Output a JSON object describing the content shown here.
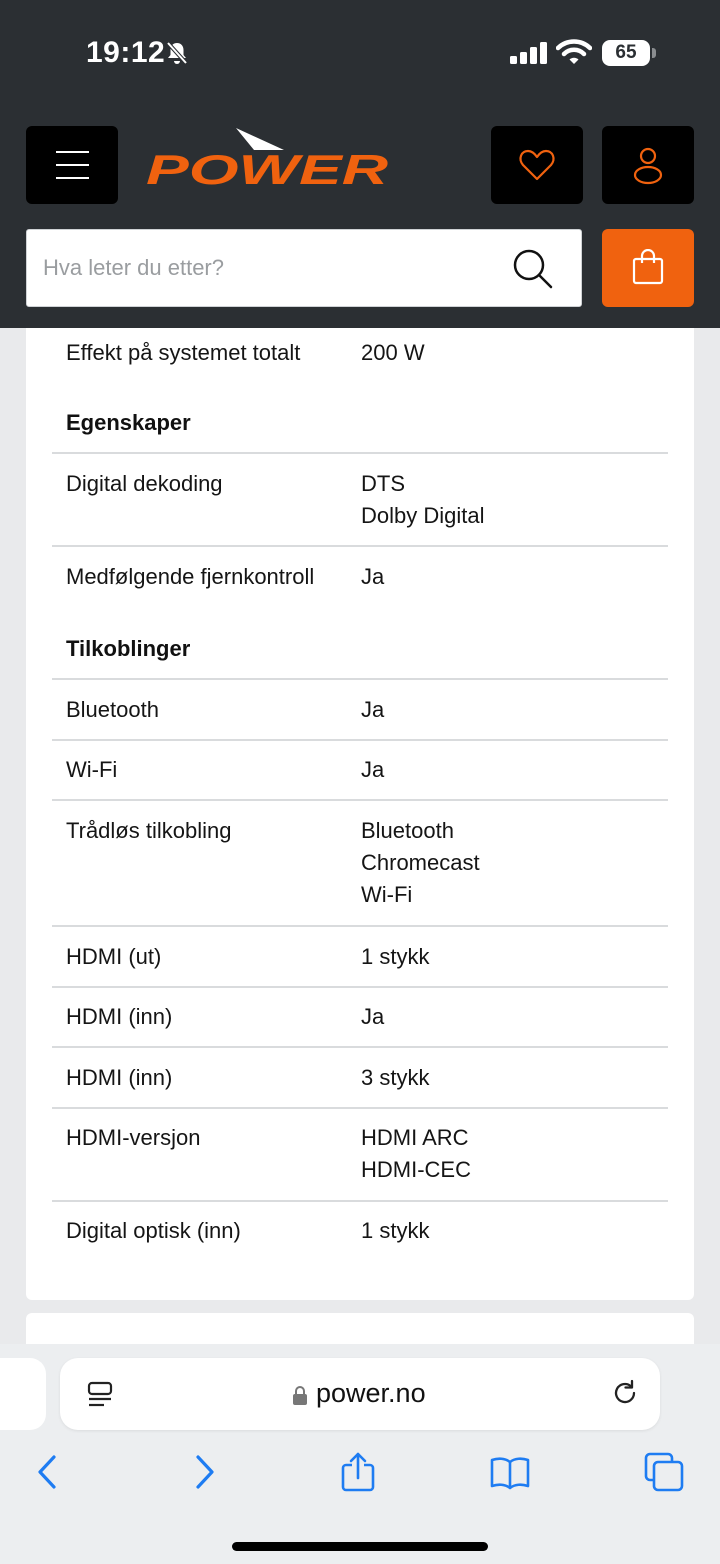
{
  "status_bar": {
    "time": "19:12",
    "battery": "65"
  },
  "header": {
    "logo_text": "POWER",
    "search_placeholder": "Hva leter du etter?",
    "accent_color": "#f0620f"
  },
  "specs": {
    "top_row": {
      "key": "Effekt på systemet totalt",
      "value": [
        "200 W"
      ]
    },
    "sections": [
      {
        "title": "Egenskaper",
        "rows": [
          {
            "key": "Digital dekoding",
            "value": [
              "DTS",
              "Dolby Digital"
            ]
          },
          {
            "key": "Medfølgende fjernkontroll",
            "value": [
              "Ja"
            ]
          }
        ]
      },
      {
        "title": "Tilkoblinger",
        "rows": [
          {
            "key": "Bluetooth",
            "value": [
              "Ja"
            ]
          },
          {
            "key": "Wi-Fi",
            "value": [
              "Ja"
            ]
          },
          {
            "key": "Trådløs tilkobling",
            "value": [
              "Bluetooth",
              "Chromecast",
              "Wi-Fi"
            ]
          },
          {
            "key": "HDMI (ut)",
            "value": [
              "1 stykk"
            ]
          },
          {
            "key": "HDMI (inn)",
            "value": [
              "Ja"
            ]
          },
          {
            "key": "HDMI (inn)",
            "value": [
              "3 stykk"
            ]
          },
          {
            "key": "HDMI-versjon",
            "value": [
              "HDMI ARC",
              "HDMI-CEC"
            ]
          },
          {
            "key": "Digital optisk (inn)",
            "value": [
              "1 stykk"
            ]
          }
        ]
      }
    ]
  },
  "browser": {
    "url": "power.no"
  }
}
